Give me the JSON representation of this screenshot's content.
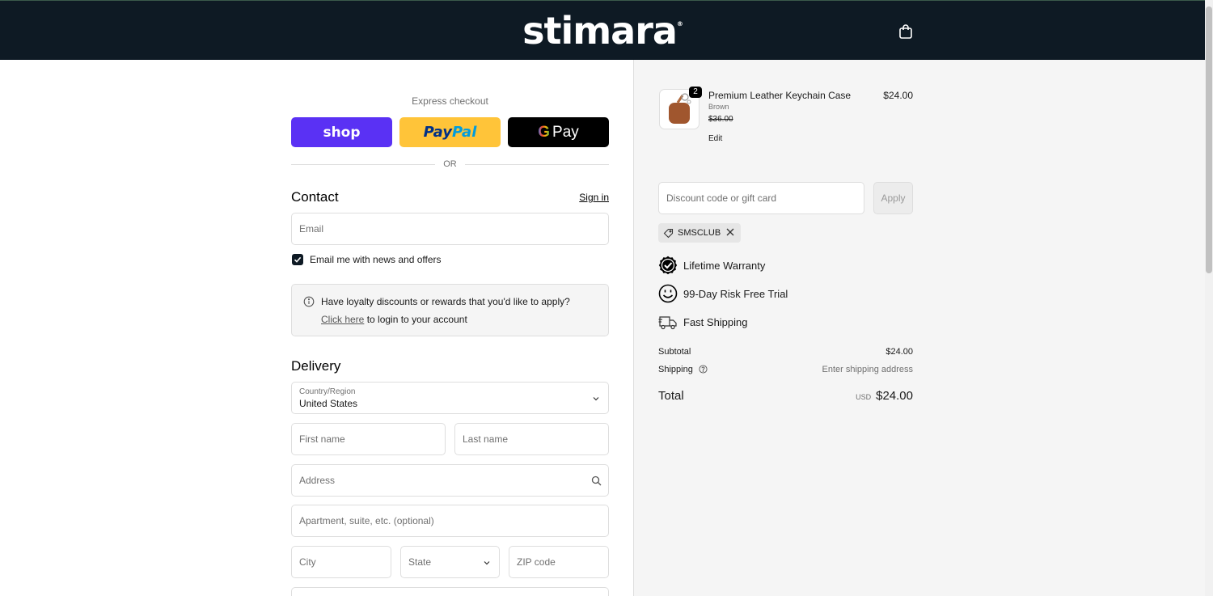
{
  "header": {
    "logo": "stimara",
    "logo_mark": "®"
  },
  "express": {
    "label": "Express checkout",
    "shop_label": "shop",
    "paypal_pay": "Pay",
    "paypal_pal": "Pal",
    "gpay_g": "G",
    "gpay_label": "Pay",
    "or_label": "OR"
  },
  "contact": {
    "title": "Contact",
    "sign_in": "Sign in",
    "email_placeholder": "Email",
    "newsletter_label": "Email me with news and offers",
    "newsletter_checked": true
  },
  "loyalty": {
    "question": "Have loyalty discounts or rewards that you'd like to apply?",
    "link": "Click here",
    "link_suffix": " to login to your account"
  },
  "delivery": {
    "title": "Delivery",
    "country_label": "Country/Region",
    "country_value": "United States",
    "first_name_placeholder": "First name",
    "last_name_placeholder": "Last name",
    "address_placeholder": "Address",
    "apartment_placeholder": "Apartment, suite, etc. (optional)",
    "city_placeholder": "City",
    "state_placeholder": "State",
    "zip_placeholder": "ZIP code"
  },
  "order": {
    "product_name": "Premium Leather Keychain Case",
    "variant": "Brown",
    "compare_price": "$36.00",
    "price": "$24.00",
    "quantity": "2",
    "edit_label": "Edit"
  },
  "discount": {
    "placeholder": "Discount code or gift card",
    "apply_label": "Apply",
    "applied_code": "SMSCLUB"
  },
  "perks": {
    "warranty": "Lifetime Warranty",
    "trial": "99-Day Risk Free Trial",
    "shipping": "Fast Shipping"
  },
  "summary": {
    "subtotal_label": "Subtotal",
    "subtotal_value": "$24.00",
    "shipping_label": "Shipping",
    "shipping_value": "Enter shipping address",
    "total_label": "Total",
    "currency": "USD",
    "total_value": "$24.00"
  },
  "colors": {
    "header_bg": "#0e1a24",
    "shop_purple": "#5a31f4",
    "paypal_yellow": "#ffc439",
    "summary_bg": "#f5f5f5"
  }
}
